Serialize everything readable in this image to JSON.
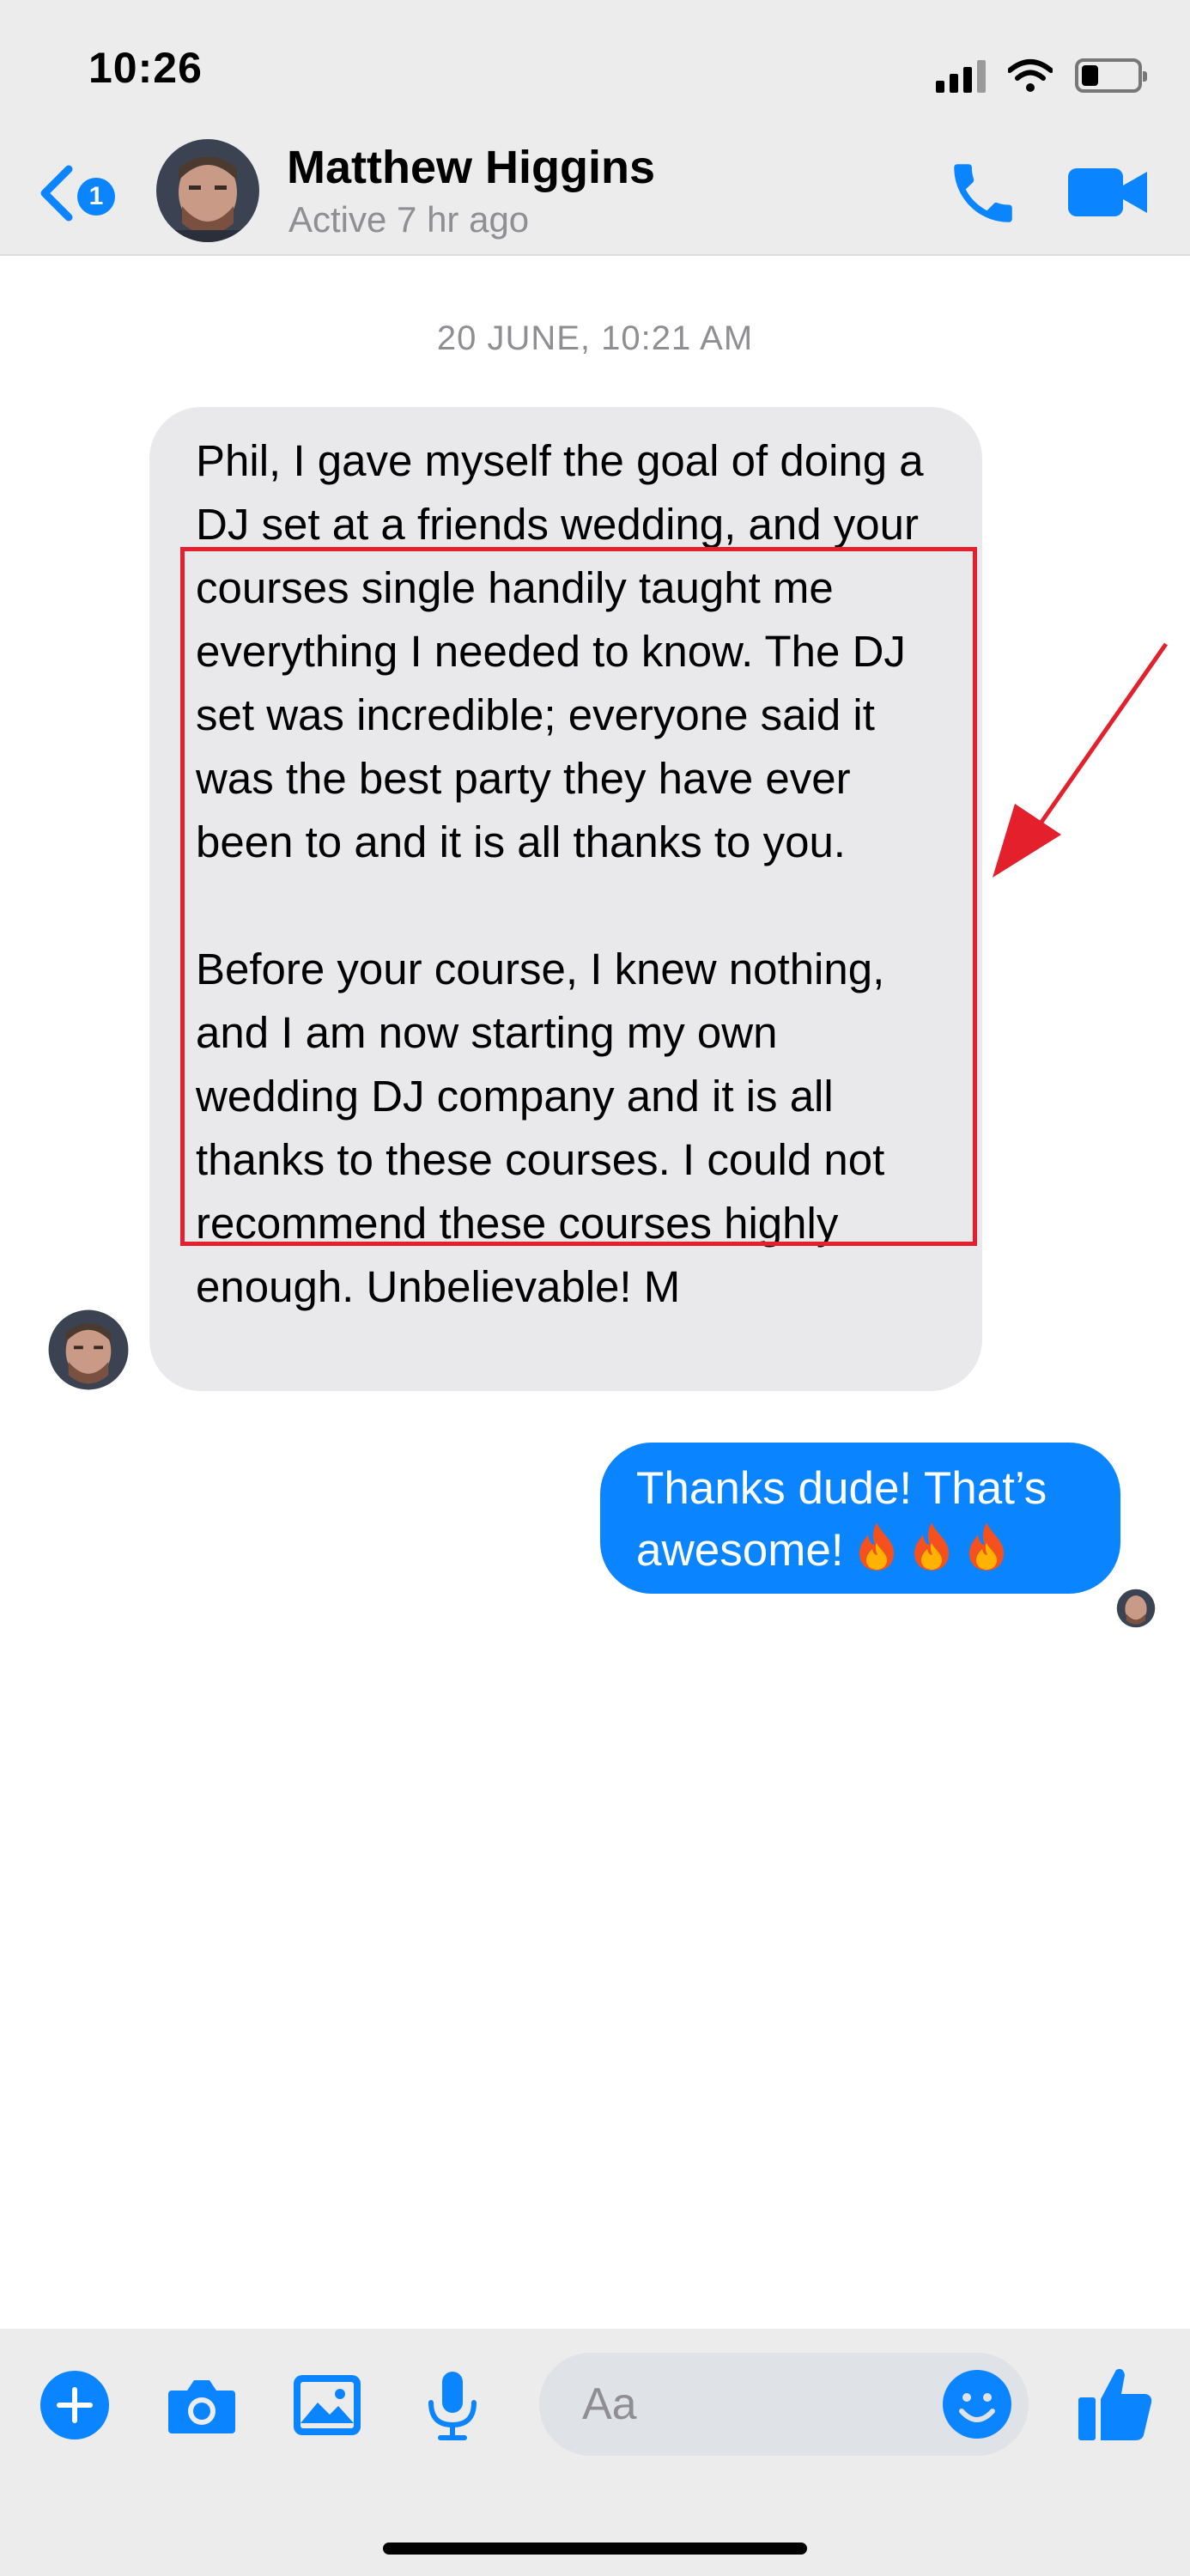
{
  "status_bar": {
    "time": "10:26",
    "battery_level": 0.3
  },
  "header": {
    "back_badge": "1",
    "contact_name": "Matthew Higgins",
    "contact_status": "Active 7 hr ago"
  },
  "conversation": {
    "date_stamp": "20 JUNE, 10:21 AM",
    "incoming_message": {
      "paragraph_1": "Phil, I gave myself the goal of doing a DJ set at a friends wedding, and your courses single handily taught me everything I needed to know. The DJ set was incredible; everyone said it was the best party they have ever been to and it is all thanks to you.",
      "paragraph_2": "Before your course, I knew nothing, and I am now starting my own wedding DJ company and it is all thanks to these courses. I could not recommend these courses highly enough. Unbelievable! M"
    },
    "outgoing_message": {
      "text": "Thanks dude! That’s awesome!",
      "emoji_count": 3
    }
  },
  "composer": {
    "placeholder": "Aa"
  },
  "colors": {
    "accent": "#0a84ff",
    "highlight": "#e3202b",
    "incoming_bubble": "#e9e9eb"
  },
  "icons": [
    "back-chevron-icon",
    "phone-icon",
    "video-camera-icon",
    "plus-icon",
    "camera-icon",
    "photo-icon",
    "microphone-icon",
    "emoji-icon",
    "thumbs-up-icon",
    "fire-emoji-icon"
  ]
}
